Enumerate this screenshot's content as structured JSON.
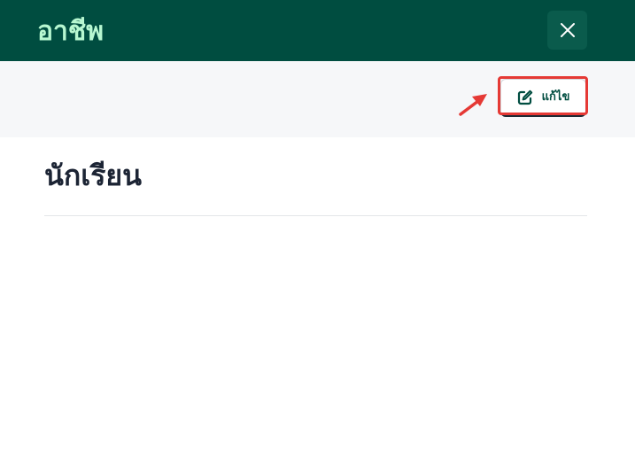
{
  "header": {
    "title": "อาชีพ",
    "close_icon": "close-icon"
  },
  "toolbar": {
    "edit_label": "แก้ไข",
    "edit_icon": "edit-icon"
  },
  "content": {
    "occupation_value": "นักเรียน"
  },
  "colors": {
    "header_bg": "#004d40",
    "title_text": "#b7f7d1",
    "highlight": "#e53935"
  }
}
